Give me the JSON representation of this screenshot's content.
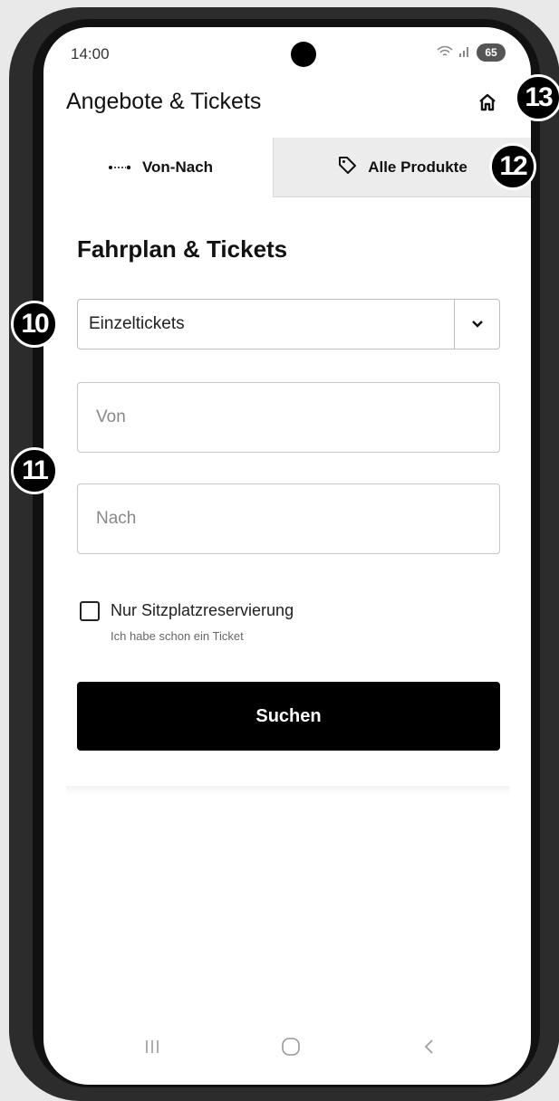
{
  "status_bar": {
    "time": "14:00",
    "battery": "65"
  },
  "header": {
    "title": "Angebote & Tickets"
  },
  "tabs": [
    {
      "label": "Von-Nach",
      "icon": "route-icon",
      "active": true
    },
    {
      "label": "Alle Produkte",
      "icon": "tag-icon",
      "active": false
    }
  ],
  "main": {
    "section_title": "Fahrplan & Tickets",
    "ticket_type": {
      "selected": "Einzeltickets"
    },
    "from_field": {
      "placeholder": "Von"
    },
    "to_field": {
      "placeholder": "Nach"
    },
    "seat_reservation": {
      "label": "Nur Sitzplatzreservierung",
      "sublabel": "Ich habe schon ein Ticket"
    },
    "search_button": "Suchen"
  },
  "callouts": {
    "c10": "10",
    "c11": "11",
    "c12": "12",
    "c13": "13"
  }
}
